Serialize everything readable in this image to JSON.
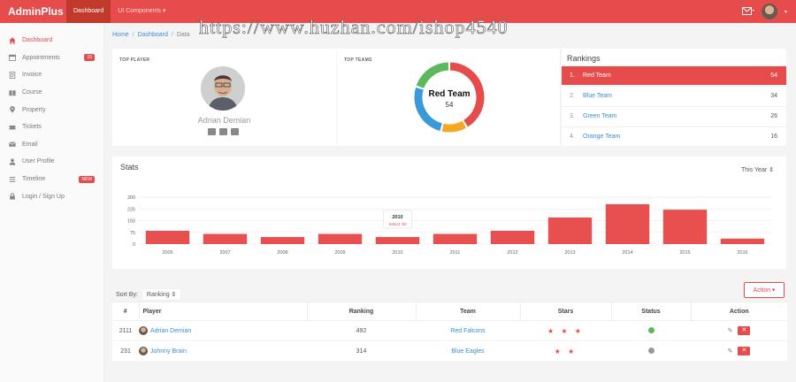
{
  "app": {
    "brand": "AdminPlus"
  },
  "topnav": {
    "dashboard": "Dashboard",
    "ui_components": "UI Components ▾"
  },
  "watermark": "https://www.huzhan.com/ishop4540",
  "sidebar": {
    "items": [
      {
        "label": "Dashboard",
        "icon": "home-icon",
        "active": true
      },
      {
        "label": "Appointments",
        "icon": "calendar-icon",
        "badge": "10"
      },
      {
        "label": "Invoice",
        "icon": "invoice-icon"
      },
      {
        "label": "Course",
        "icon": "book-icon"
      },
      {
        "label": "Property",
        "icon": "map-pin-icon"
      },
      {
        "label": "Tickets",
        "icon": "ticket-icon"
      },
      {
        "label": "Email",
        "icon": "mail-icon"
      },
      {
        "label": "User Profile",
        "icon": "user-icon"
      },
      {
        "label": "Timeline",
        "icon": "list-icon",
        "badge": "NEW"
      },
      {
        "label": "Login / Sign Up",
        "icon": "lock-icon"
      }
    ]
  },
  "breadcrumb": {
    "home": "Home",
    "dashboard": "Dashboard",
    "current": "Data"
  },
  "top_player": {
    "title": "TOP PLAYER",
    "name": "Adrian Demian"
  },
  "top_teams": {
    "title": "TOP TEAMS",
    "center_team": "Red Team",
    "center_value": "54",
    "segments": [
      {
        "name": "Red Team",
        "value": 54,
        "color": "#e74c4c"
      },
      {
        "name": "Orange Team",
        "value": 16,
        "color": "#f5a623"
      },
      {
        "name": "Blue Team",
        "value": 34,
        "color": "#3a9ad9"
      },
      {
        "name": "Green Team",
        "value": 26,
        "color": "#5cb85c"
      }
    ]
  },
  "rankings": {
    "title": "Rankings",
    "rows": [
      {
        "num": "1.",
        "name": "Red Team",
        "points": "54",
        "active": true
      },
      {
        "num": "2.",
        "name": "Blue Team",
        "points": "34"
      },
      {
        "num": "3.",
        "name": "Green Team",
        "points": "26"
      },
      {
        "num": "4.",
        "name": "Orange Team",
        "points": "16"
      }
    ]
  },
  "stats": {
    "title": "Stats",
    "period": "This Year",
    "tooltip_year": "2010",
    "tooltip_text": "Select: 50"
  },
  "chart_data": {
    "type": "bar",
    "categories": [
      "2005",
      "2007",
      "2008",
      "2009",
      "2010",
      "2011",
      "2012",
      "2013",
      "2014",
      "2015",
      "2016"
    ],
    "values": [
      85,
      65,
      45,
      65,
      45,
      65,
      85,
      170,
      255,
      220,
      35
    ],
    "yticks": [
      "0",
      "75",
      "150",
      "225",
      "300"
    ],
    "ylim": [
      0,
      300
    ],
    "color": "#e8504f"
  },
  "table": {
    "sort_label": "Sort By:",
    "sort_value": "Ranking",
    "action_label": "Action ▾",
    "headers": [
      "#",
      "Player",
      "Ranking",
      "Team",
      "Stars",
      "Status",
      "Action"
    ],
    "rows": [
      {
        "id": "2111",
        "player": "Adrian Demian",
        "ranking": "492",
        "team": "Red Falcons",
        "stars": "★ ★ ★",
        "status_color": "#5cb85c"
      },
      {
        "id": "231",
        "player": "Johnny Brain",
        "ranking": "314",
        "team": "Blue Eagles",
        "stars": "★ ★",
        "status_color": "#999999"
      }
    ]
  }
}
